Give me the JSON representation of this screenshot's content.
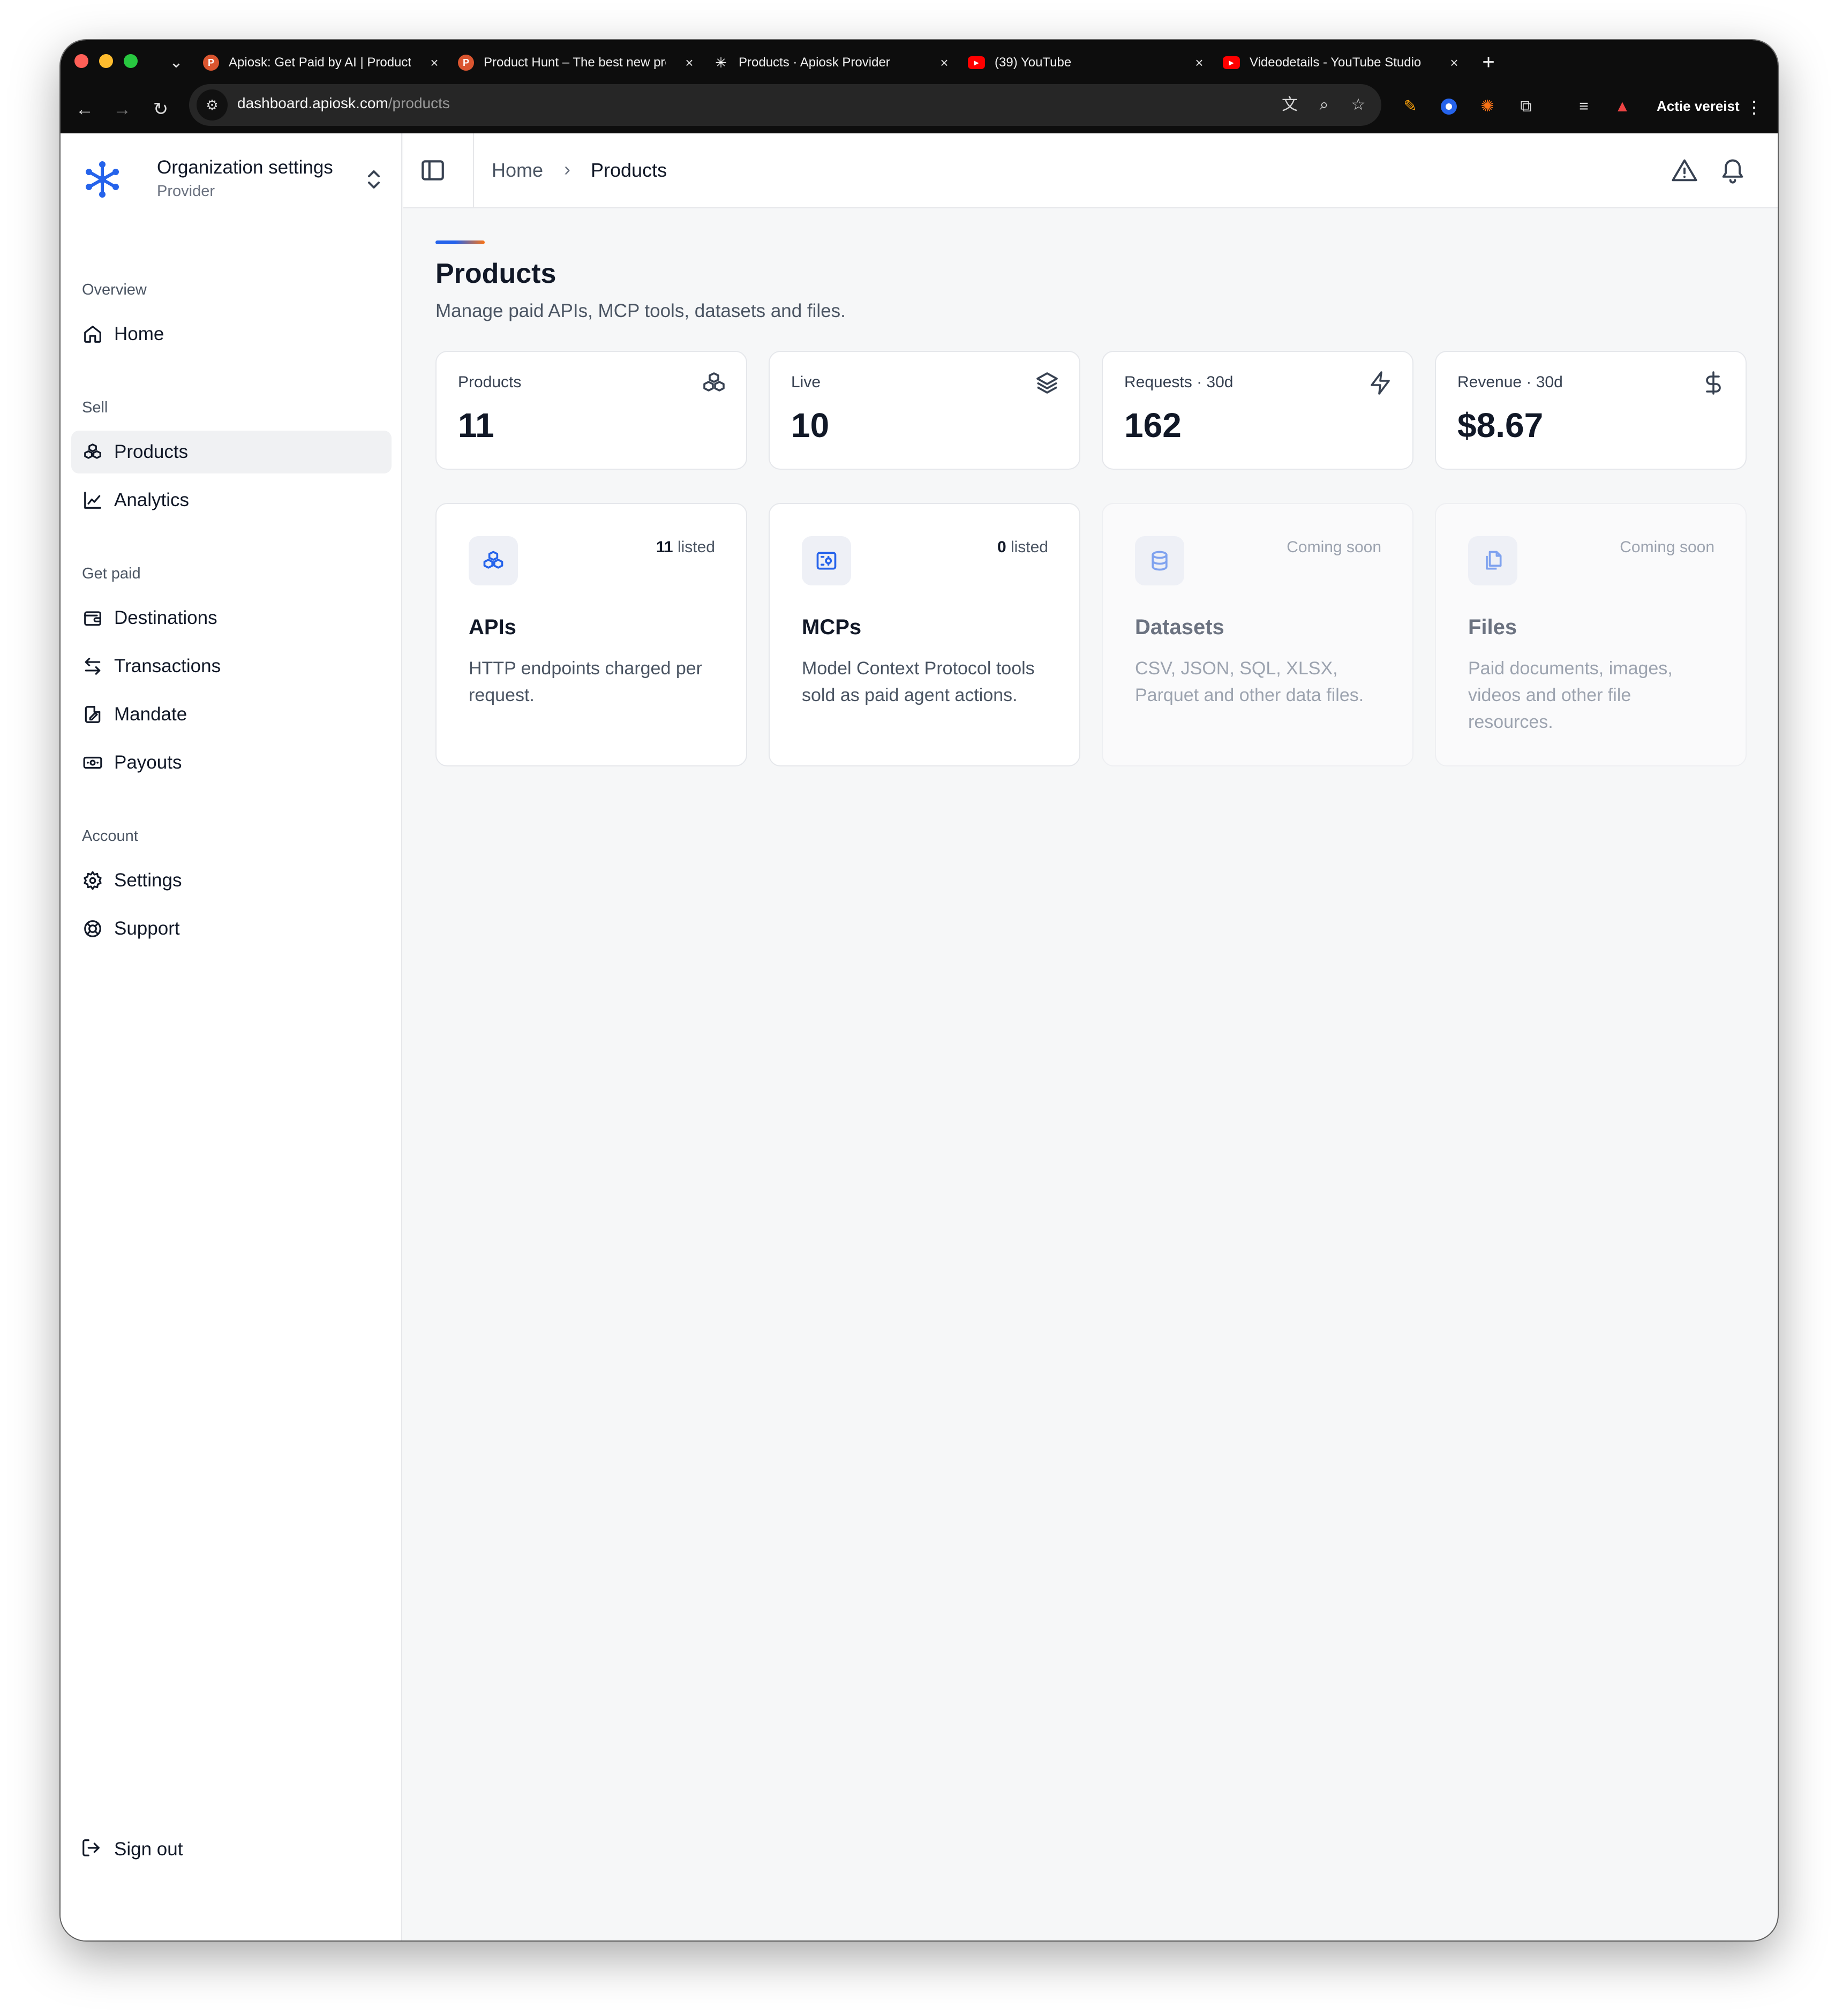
{
  "browser": {
    "tabs": [
      {
        "label": "Apiosk: Get Paid by AI | Product Hunt",
        "favicon": "product-hunt-icon",
        "color": "#da552f"
      },
      {
        "label": "Product Hunt – The best new products",
        "favicon": "product-hunt-icon",
        "color": "#da552f"
      },
      {
        "label": "Products · Apiosk Provider",
        "favicon": "apiosk-icon",
        "color": "#ffffff"
      },
      {
        "label": "(39) YouTube",
        "favicon": "youtube-icon",
        "color": "#ff0000"
      },
      {
        "label": "Videodetails - YouTube Studio",
        "favicon": "youtube-icon",
        "color": "#ff0000"
      }
    ],
    "url_host": "dashboard.apiosk.com",
    "url_path": "/products",
    "profile_label": "Actie vereist"
  },
  "sidebar": {
    "org_title": "Organization settings",
    "org_subtitle": "Provider",
    "sections": {
      "overview": "Overview",
      "sell": "Sell",
      "get_paid": "Get paid",
      "account": "Account"
    },
    "items": {
      "home": "Home",
      "products": "Products",
      "analytics": "Analytics",
      "destinations": "Destinations",
      "transactions": "Transactions",
      "mandate": "Mandate",
      "payouts": "Payouts",
      "settings": "Settings",
      "support": "Support"
    },
    "sign_out": "Sign out"
  },
  "header": {
    "breadcrumb": [
      "Home",
      "Products"
    ]
  },
  "page": {
    "title": "Products",
    "description": "Manage paid APIs, MCP tools, datasets and files."
  },
  "stats": [
    {
      "label": "Products",
      "value": "11",
      "icon": "boxes-icon"
    },
    {
      "label": "Live",
      "value": "10",
      "icon": "layers-icon"
    },
    {
      "label": "Requests · 30d",
      "value": "162",
      "icon": "zap-icon"
    },
    {
      "label": "Revenue · 30d",
      "value": "$8.67",
      "icon": "dollar-icon"
    }
  ],
  "categories": [
    {
      "title": "APIs",
      "count": "11",
      "count_suffix": " listed",
      "description": "HTTP endpoints charged per request.",
      "icon": "boxes-icon"
    },
    {
      "title": "MCPs",
      "count": "0",
      "count_suffix": " listed",
      "description": "Model Context Protocol tools sold as paid agent actions.",
      "icon": "mcp-server-icon"
    },
    {
      "title": "Datasets",
      "badge": "Coming soon",
      "description": "CSV, JSON, SQL, XLSX, Parquet and other data files.",
      "icon": "database-icon"
    },
    {
      "title": "Files",
      "badge": "Coming soon",
      "description": "Paid documents, images, videos and other file resources.",
      "icon": "files-icon"
    }
  ],
  "colors": {
    "brand": "#2563eb",
    "accent_orange": "#f97316",
    "active_nav": "#f0f1f3"
  }
}
